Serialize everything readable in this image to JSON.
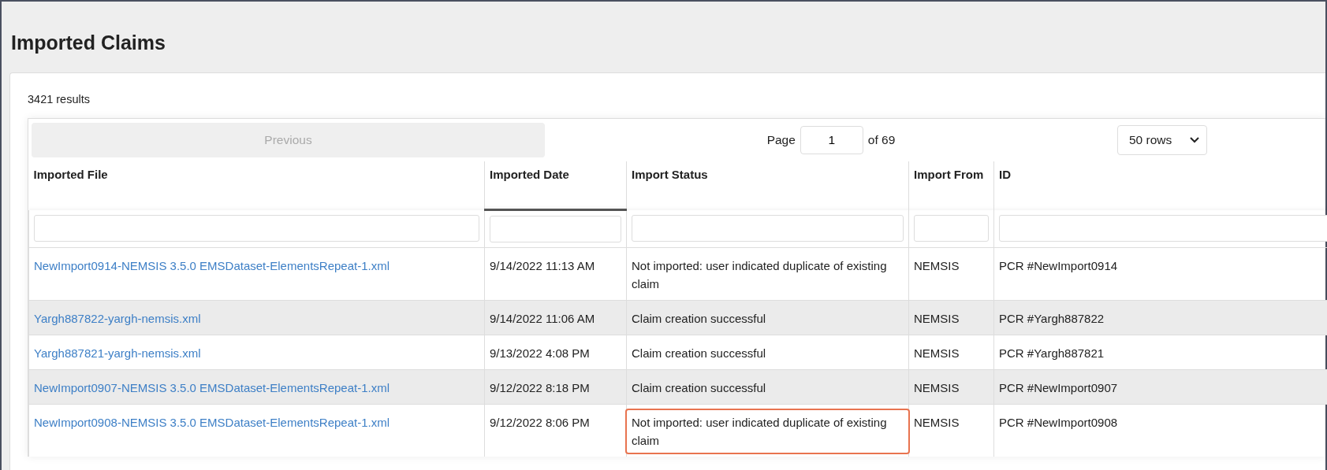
{
  "page": {
    "title": "Imported Claims"
  },
  "results": "3421 results",
  "pager": {
    "previous": {
      "label": "Previous",
      "disabled": true
    },
    "page_label": "Page",
    "page_value": "1",
    "page_total": "of 69",
    "rows_select": "50 rows"
  },
  "table": {
    "columns": [
      {
        "label": "Imported File",
        "sorted": false
      },
      {
        "label": "Imported Date",
        "sorted": true
      },
      {
        "label": "Import Status",
        "sorted": false
      },
      {
        "label": "Import From",
        "sorted": false
      },
      {
        "label": "ID",
        "sorted": false
      }
    ],
    "rows": [
      {
        "file": "NewImport0914-NEMSIS 3.5.0 EMSDataset-ElementsRepeat-1.xml",
        "date": "9/14/2022 11:13 AM",
        "status": "Not imported: user indicated duplicate of existing claim",
        "status_highlighted": false,
        "from": "NEMSIS",
        "id": "PCR #NewImport0914"
      },
      {
        "file": "Yargh887822-yargh-nemsis.xml",
        "date": "9/14/2022 11:06 AM",
        "status": "Claim creation successful",
        "status_highlighted": false,
        "from": "NEMSIS",
        "id": "PCR #Yargh887822"
      },
      {
        "file": "Yargh887821-yargh-nemsis.xml",
        "date": "9/13/2022 4:08 PM",
        "status": "Claim creation successful",
        "status_highlighted": false,
        "from": "NEMSIS",
        "id": "PCR #Yargh887821"
      },
      {
        "file": "NewImport0907-NEMSIS 3.5.0 EMSDataset-ElementsRepeat-1.xml",
        "date": "9/12/2022 8:18 PM",
        "status": "Claim creation successful",
        "status_highlighted": false,
        "from": "NEMSIS",
        "id": "PCR #NewImport0907"
      },
      {
        "file": "NewImport0908-NEMSIS 3.5.0 EMSDataset-ElementsRepeat-1.xml",
        "date": "9/12/2022 8:06 PM",
        "status": "Not imported: user indicated duplicate of existing claim",
        "status_highlighted": true,
        "from": "NEMSIS",
        "id": "PCR #NewImport0908"
      }
    ]
  }
}
